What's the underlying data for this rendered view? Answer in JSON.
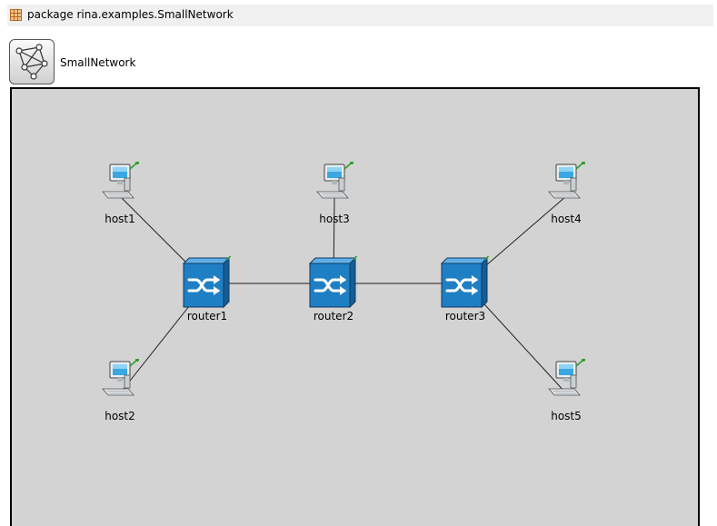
{
  "package_bar": {
    "text": "package rina.examples.SmallNetwork",
    "icon": "package-icon"
  },
  "network": {
    "title": "SmallNetwork",
    "icon": "network-module-icon",
    "background": "#d3d3d3"
  },
  "nodes": {
    "host1": {
      "label": "host1",
      "type": "host"
    },
    "host2": {
      "label": "host2",
      "type": "host"
    },
    "host3": {
      "label": "host3",
      "type": "host"
    },
    "host4": {
      "label": "host4",
      "type": "host"
    },
    "host5": {
      "label": "host5",
      "type": "host"
    },
    "router1": {
      "label": "router1",
      "type": "router"
    },
    "router2": {
      "label": "router2",
      "type": "router"
    },
    "router3": {
      "label": "router3",
      "type": "router"
    }
  },
  "connections": [
    [
      "host1",
      "router1"
    ],
    [
      "host2",
      "router1"
    ],
    [
      "router1",
      "router2"
    ],
    [
      "host3",
      "router2"
    ],
    [
      "router2",
      "router3"
    ],
    [
      "host4",
      "router3"
    ],
    [
      "host5",
      "router3"
    ]
  ],
  "colors": {
    "router_blue": "#1f7fc4",
    "status_green": "#2e9e2e",
    "link": "#222222"
  }
}
